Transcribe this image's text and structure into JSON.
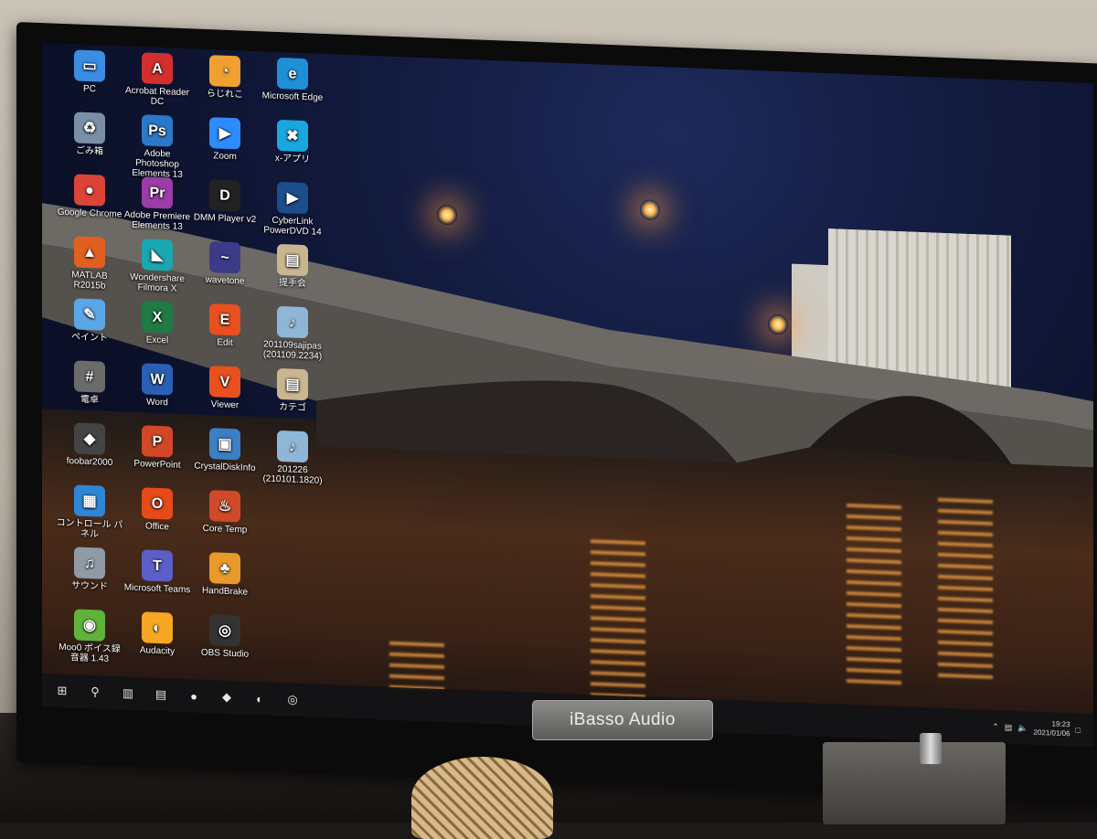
{
  "desktop": {
    "icons": [
      {
        "label": "PC",
        "glyph": "▭",
        "color": "#3a8de0",
        "icon": "pc-icon",
        "col": 0,
        "row": 0
      },
      {
        "label": "ごみ箱",
        "glyph": "♻",
        "color": "#7a8fa6",
        "icon": "recycle-bin-icon",
        "col": 0,
        "row": 1
      },
      {
        "label": "Google Chrome",
        "glyph": "●",
        "color": "#db4437",
        "icon": "chrome-icon",
        "col": 0,
        "row": 2
      },
      {
        "label": "MATLAB R2015b",
        "glyph": "▲",
        "color": "#e1601f",
        "icon": "matlab-icon",
        "col": 0,
        "row": 3
      },
      {
        "label": "ペイント",
        "glyph": "✎",
        "color": "#5aa7e8",
        "icon": "paint-icon",
        "col": 0,
        "row": 4
      },
      {
        "label": "電卓",
        "glyph": "#",
        "color": "#6b6b6b",
        "icon": "calculator-icon",
        "col": 0,
        "row": 5
      },
      {
        "label": "foobar2000",
        "glyph": "◆",
        "color": "#444444",
        "icon": "foobar-icon",
        "col": 0,
        "row": 6
      },
      {
        "label": "コントロール パネル",
        "glyph": "▦",
        "color": "#2f86d6",
        "icon": "control-panel-icon",
        "col": 0,
        "row": 7
      },
      {
        "label": "サウンド",
        "glyph": "♫",
        "color": "#8e9aa6",
        "icon": "sound-icon",
        "col": 0,
        "row": 8
      },
      {
        "label": "Moo0 ボイス録音器 1.43",
        "glyph": "◉",
        "color": "#5fb33a",
        "icon": "moo0-recorder-icon",
        "col": 0,
        "row": 9
      },
      {
        "label": "Acrobat Reader DC",
        "glyph": "A",
        "color": "#d32f2f",
        "icon": "acrobat-icon",
        "col": 1,
        "row": 0
      },
      {
        "label": "Adobe Photoshop Elements 13",
        "glyph": "Ps",
        "color": "#2a78c8",
        "icon": "photoshop-icon",
        "col": 1,
        "row": 1
      },
      {
        "label": "Adobe Premiere Elements 13",
        "glyph": "Pr",
        "color": "#9c3ca8",
        "icon": "premiere-icon",
        "col": 1,
        "row": 2
      },
      {
        "label": "Wondershare Filmora X",
        "glyph": "◣",
        "color": "#1aa7b0",
        "icon": "filmora-icon",
        "col": 1,
        "row": 3
      },
      {
        "label": "Excel",
        "glyph": "X",
        "color": "#1f7a44",
        "icon": "excel-icon",
        "col": 1,
        "row": 4
      },
      {
        "label": "Word",
        "glyph": "W",
        "color": "#2b5fb4",
        "icon": "word-icon",
        "col": 1,
        "row": 5
      },
      {
        "label": "PowerPoint",
        "glyph": "P",
        "color": "#d24726",
        "icon": "powerpoint-icon",
        "col": 1,
        "row": 6
      },
      {
        "label": "Office",
        "glyph": "O",
        "color": "#e64a19",
        "icon": "office-icon",
        "col": 1,
        "row": 7
      },
      {
        "label": "Microsoft Teams",
        "glyph": "T",
        "color": "#5b5fc7",
        "icon": "teams-icon",
        "col": 1,
        "row": 8
      },
      {
        "label": "Audacity",
        "glyph": "◐",
        "color": "#f5a623",
        "icon": "audacity-icon",
        "col": 1,
        "row": 9
      },
      {
        "label": "らじれこ",
        "glyph": "◔",
        "color": "#f0a030",
        "icon": "rajireko-icon",
        "col": 2,
        "row": 0
      },
      {
        "label": "Zoom",
        "glyph": "▶",
        "color": "#2d8cff",
        "icon": "zoom-icon",
        "col": 2,
        "row": 1
      },
      {
        "label": "DMM Player v2",
        "glyph": "D",
        "color": "#222222",
        "icon": "dmm-player-icon",
        "col": 2,
        "row": 2
      },
      {
        "label": "wavetone",
        "glyph": "~",
        "color": "#3b3b8a",
        "icon": "wavetone-icon",
        "col": 2,
        "row": 3
      },
      {
        "label": "Edit",
        "glyph": "E",
        "color": "#e8501f",
        "icon": "edit-icon",
        "col": 2,
        "row": 4
      },
      {
        "label": "Viewer",
        "glyph": "V",
        "color": "#e8501f",
        "icon": "viewer-icon",
        "col": 2,
        "row": 5
      },
      {
        "label": "CrystalDiskInfo",
        "glyph": "▣",
        "color": "#3b7fc4",
        "icon": "crystaldiskinfo-icon",
        "col": 2,
        "row": 6
      },
      {
        "label": "Core Temp",
        "glyph": "♨",
        "color": "#d04a2a",
        "icon": "core-temp-icon",
        "col": 2,
        "row": 7
      },
      {
        "label": "HandBrake",
        "glyph": "♣",
        "color": "#e89a2a",
        "icon": "handbrake-icon",
        "col": 2,
        "row": 8
      },
      {
        "label": "OBS Studio",
        "glyph": "◎",
        "color": "#333333",
        "icon": "obs-icon",
        "col": 2,
        "row": 9
      },
      {
        "label": "Microsoft Edge",
        "glyph": "e",
        "color": "#1f8fd8",
        "icon": "edge-icon",
        "col": 3,
        "row": 0
      },
      {
        "label": "x-アプリ",
        "glyph": "✖",
        "color": "#1aa7e0",
        "icon": "x-app-icon",
        "col": 3,
        "row": 1
      },
      {
        "label": "CyberLink PowerDVD 14",
        "glyph": "▶",
        "color": "#1b4e8a",
        "icon": "powerdvd-icon",
        "col": 3,
        "row": 2
      },
      {
        "label": "提手会",
        "glyph": "▤",
        "color": "#c9b58f",
        "icon": "document-icon",
        "col": 3,
        "row": 3
      },
      {
        "label": "201109sajipas (201109.2234)",
        "glyph": "♪",
        "color": "#8fb6d6",
        "icon": "audio-file-icon",
        "col": 3,
        "row": 4
      },
      {
        "label": "カテゴ",
        "glyph": "▤",
        "color": "#c9b58f",
        "icon": "document-icon",
        "col": 3,
        "row": 5
      },
      {
        "label": "201226 (210101.1820)",
        "glyph": "♪",
        "color": "#8fb6d6",
        "icon": "audio-file-icon",
        "col": 3,
        "row": 6
      }
    ]
  },
  "taskbar": {
    "buttons": [
      {
        "name": "start-button",
        "glyph": "⊞"
      },
      {
        "name": "search-icon",
        "glyph": "⚲"
      },
      {
        "name": "task-view-icon",
        "glyph": "▥"
      },
      {
        "name": "file-explorer-icon",
        "glyph": "▤"
      },
      {
        "name": "chrome-taskbar-icon",
        "glyph": "●"
      },
      {
        "name": "foobar-taskbar-icon",
        "glyph": "◆"
      },
      {
        "name": "edge-taskbar-icon",
        "glyph": "◐"
      },
      {
        "name": "obs-taskbar-icon",
        "glyph": "◎"
      }
    ],
    "clock_time": "19:23",
    "clock_date": "2021/01/06"
  },
  "monitor": {
    "brand_label": "iBasso Audio"
  }
}
